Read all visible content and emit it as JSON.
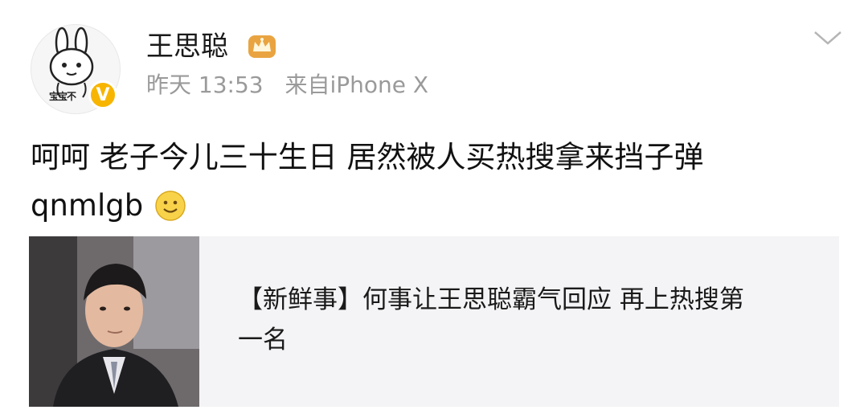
{
  "header": {
    "username": "王思聪",
    "time": "昨天 13:53",
    "source": "来自iPhone X",
    "avatar_caption": "宝宝不",
    "verified_badge": "V"
  },
  "post": {
    "line1": "呵呵 老子今儿三十生日 居然被人买热搜拿来挡子弹",
    "line2": "qnmlgb"
  },
  "card": {
    "line1": "【新鲜事】何事让王思聪霸气回应 再上热搜第",
    "line2": "一名"
  },
  "icons": {
    "crown": "crown-icon",
    "chevron": "chevron-down-icon",
    "smile": "smile-emoji-icon",
    "verified": "verified-icon"
  },
  "colors": {
    "meta_gray": "#9a9a9a",
    "verified_yellow": "#f7b500",
    "card_bg": "#f4f3f5"
  }
}
